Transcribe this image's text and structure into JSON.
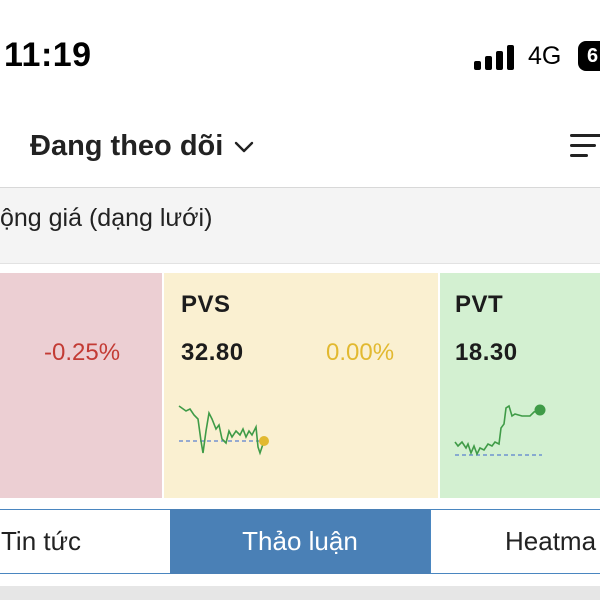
{
  "status_bar": {
    "time": "11:19",
    "network": "4G",
    "battery": "6"
  },
  "header": {
    "title": "Đang theo dõi",
    "dropdown_icon": "chevron-down-icon",
    "menu_icon": "sort-lines-icon"
  },
  "section": {
    "title": "ộng giá (dạng lưới)"
  },
  "cards": [
    {
      "symbol": "",
      "price": "",
      "change": "-0.25%",
      "color": "#c33b34",
      "bg": "#eccfd3"
    },
    {
      "symbol": "PVS",
      "price": "32.80",
      "change": "0.00%",
      "color": "#e2b930",
      "bg": "#faf0d1"
    },
    {
      "symbol": "PVT",
      "price": "18.30",
      "change": "",
      "color": "#3f9b47",
      "bg": "#d3f0d1"
    }
  ],
  "tabs": [
    {
      "label": "Tin tức",
      "active": false
    },
    {
      "label": "Thảo luận",
      "active": true
    },
    {
      "label": "Heatma",
      "active": false
    }
  ],
  "colors": {
    "accent": "#4a80b6",
    "up": "#3f9b47",
    "down": "#c33b34",
    "ref": "#e2b930"
  }
}
